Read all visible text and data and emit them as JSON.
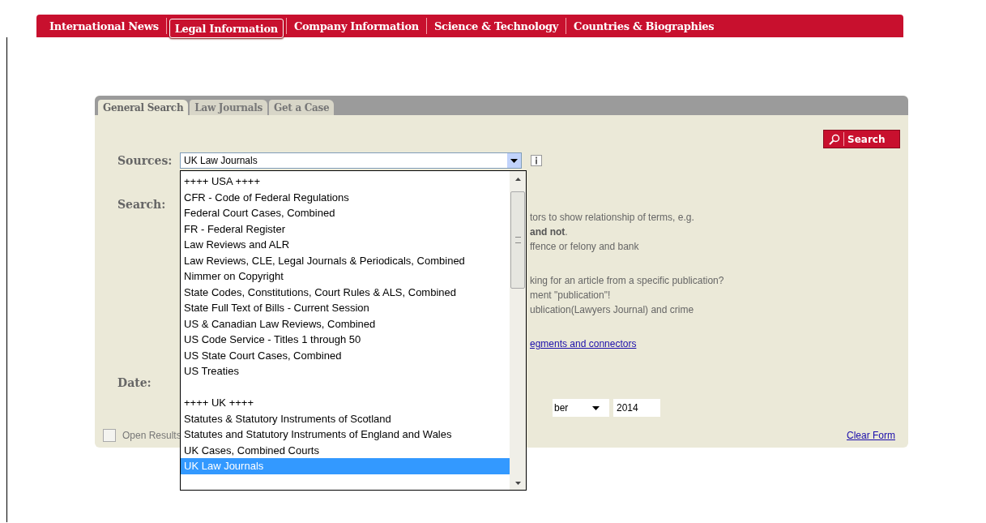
{
  "nav": [
    {
      "label": "International News",
      "selected": false
    },
    {
      "label": "Legal Information",
      "selected": true
    },
    {
      "label": "Company Information",
      "selected": false
    },
    {
      "label": "Science & Technology",
      "selected": false
    },
    {
      "label": "Countries & Biographies",
      "selected": false
    }
  ],
  "tabs": [
    {
      "label": "General Search",
      "selected": true
    },
    {
      "label": "Law Journals",
      "selected": false
    },
    {
      "label": "Get a Case",
      "selected": false
    }
  ],
  "search_button": {
    "label": "Search"
  },
  "sources": {
    "label": "Sources:",
    "value": "UK Law Journals",
    "options": [
      {
        "kind": "heading",
        "label": "++++ USA ++++"
      },
      {
        "kind": "option",
        "label": "CFR - Code of Federal Regulations",
        "selected": false
      },
      {
        "kind": "option",
        "label": "Federal Court Cases, Combined",
        "selected": false
      },
      {
        "kind": "option",
        "label": "FR - Federal Register",
        "selected": false
      },
      {
        "kind": "option",
        "label": "Law Reviews and ALR",
        "selected": false
      },
      {
        "kind": "option",
        "label": "Law Reviews, CLE, Legal Journals & Periodicals, Combined",
        "selected": false
      },
      {
        "kind": "option",
        "label": "Nimmer on Copyright",
        "selected": false
      },
      {
        "kind": "option",
        "label": "State Codes, Constitutions, Court Rules & ALS, Combined",
        "selected": false
      },
      {
        "kind": "option",
        "label": "State Full Text of Bills - Current Session",
        "selected": false
      },
      {
        "kind": "option",
        "label": "US & Canadian Law Reviews, Combined",
        "selected": false
      },
      {
        "kind": "option",
        "label": "US Code Service - Titles 1 through 50",
        "selected": false
      },
      {
        "kind": "option",
        "label": "US State Court Cases, Combined",
        "selected": false
      },
      {
        "kind": "option",
        "label": "US Treaties",
        "selected": false
      },
      {
        "kind": "blank"
      },
      {
        "kind": "heading",
        "label": "++++ UK ++++"
      },
      {
        "kind": "option",
        "label": "Statutes & Statutory Instruments of Scotland",
        "selected": false
      },
      {
        "kind": "option",
        "label": "Statutes and Statutory Instruments of England and Wales",
        "selected": false
      },
      {
        "kind": "option",
        "label": "UK Cases, Combined Courts",
        "selected": false
      },
      {
        "kind": "option",
        "label": "UK Law Journals",
        "selected": true
      }
    ]
  },
  "search": {
    "label": "Search:",
    "help_groups": [
      {
        "lines": [
          {
            "kind": "text",
            "text": "tors to show relationship of terms, e.g."
          },
          {
            "kind": "text",
            "text": "**and not**."
          },
          {
            "kind": "text",
            "text": "ffence or felony and bank"
          }
        ]
      },
      {
        "lines": [
          {
            "kind": "text",
            "text": "king for an article from a specific publication?"
          },
          {
            "kind": "text",
            "text": "ment \"publication\"!"
          },
          {
            "kind": "text",
            "text": "ublication(Lawyers Journal) and crime"
          }
        ]
      },
      {
        "lines": [
          {
            "kind": "link",
            "text": "egments and connectors"
          }
        ]
      }
    ]
  },
  "date": {
    "label": "Date:",
    "month": "ber",
    "year": "2014"
  },
  "open_results": {
    "label": "Open Results",
    "checked": false
  },
  "clear_form": {
    "label": "Clear Form"
  }
}
